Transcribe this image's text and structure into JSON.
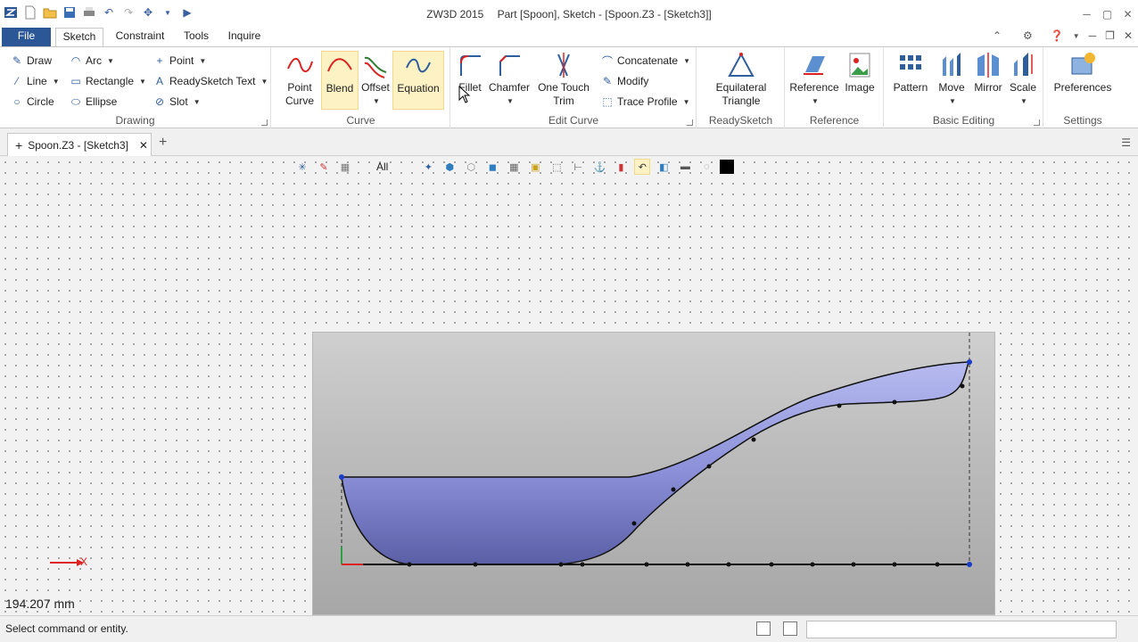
{
  "app": {
    "title_app": "ZW3D 2015",
    "title_doc": "Part [Spoon],  Sketch - [Spoon.Z3 - [Sketch3]]"
  },
  "ribbon_tabs": [
    "File",
    "Sketch",
    "Constraint",
    "Tools",
    "Inquire"
  ],
  "groups": {
    "drawing": {
      "label": "Drawing",
      "items": {
        "draw": "Draw",
        "arc": "Arc",
        "point": "Point",
        "line": "Line",
        "rectangle": "Rectangle",
        "readysketch_text": "ReadySketch Text",
        "circle": "Circle",
        "ellipse": "Ellipse",
        "slot": "Slot"
      }
    },
    "curve": {
      "label": "Curve",
      "point_curve": "Point Curve",
      "blend": "Blend",
      "offset": "Offset",
      "equation": "Equation"
    },
    "edit_curve": {
      "label": "Edit Curve",
      "fillet": "Fillet",
      "chamfer": "Chamfer",
      "one_touch_trim": "One Touch Trim",
      "concatenate": "Concatenate",
      "modify": "Modify",
      "trace_profile": "Trace Profile"
    },
    "readysketch": {
      "label": "ReadySketch",
      "equilateral_triangle": "Equilateral Triangle"
    },
    "reference": {
      "label": "Reference",
      "reference": "Reference",
      "image": "Image"
    },
    "basic_editing": {
      "label": "Basic Editing",
      "pattern": "Pattern",
      "move": "Move",
      "mirror": "Mirror",
      "scale": "Scale"
    },
    "settings": {
      "label": "Settings",
      "preferences": "Preferences"
    }
  },
  "document_tab": "Spoon.Z3 - [Sketch3]",
  "view_toolbar": {
    "filter": "All"
  },
  "canvas": {
    "measurement": "194.207 mm",
    "axis_label": "X"
  },
  "status": {
    "message": "Select command or entity."
  },
  "colors": {
    "file_tab": "#2b5797",
    "highlight": "#fdf2c3",
    "spoon_fill": "#8a8fd8",
    "sketch_line": "#111111"
  }
}
